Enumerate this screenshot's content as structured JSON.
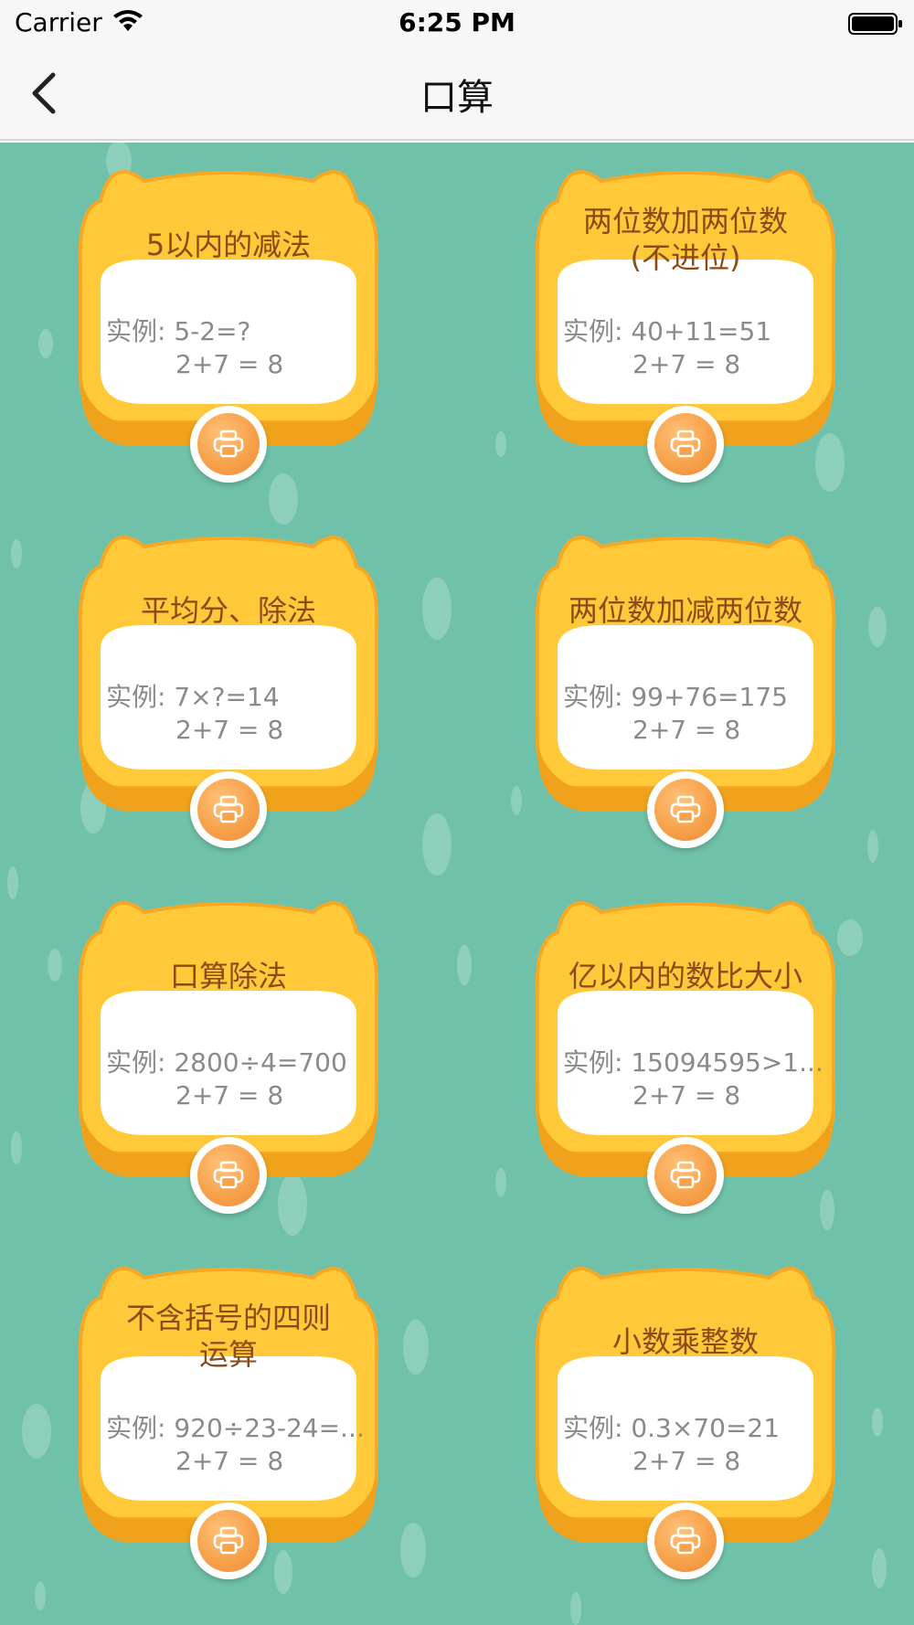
{
  "status_bar": {
    "carrier": "Carrier",
    "time": "6:25 PM"
  },
  "nav": {
    "title": "口算"
  },
  "colors": {
    "background": "#6fc2a9",
    "card_yellow": "#ffc93a",
    "title_brown": "#8b4a16",
    "print_orange": "#f7a24b"
  },
  "cards": [
    {
      "title": "5以内的减法",
      "example": "实例: 5-2=?",
      "formula": "2+7 = 8"
    },
    {
      "title": "两位数加两位数",
      "title2": "(不进位)",
      "example": "实例: 40+11=51",
      "formula": "2+7 = 8"
    },
    {
      "title": "平均分、除法",
      "example": "实例: 7×?=14",
      "formula": "2+7 = 8"
    },
    {
      "title": "两位数加减两位数",
      "example": "实例: 99+76=175",
      "formula": "2+7 = 8"
    },
    {
      "title": "口算除法",
      "example": "实例: 2800÷4=700",
      "formula": "2+7 = 8"
    },
    {
      "title": "亿以内的数比大小",
      "example": "实例: 15094595>1...",
      "formula": "2+7 = 8"
    },
    {
      "title": "不含括号的四则",
      "title2": "运算",
      "example": "实例: 920÷23-24=...",
      "formula": "2+7 = 8"
    },
    {
      "title": "小数乘整数",
      "example": "实例: 0.3×70=21",
      "formula": "2+7 = 8"
    }
  ]
}
